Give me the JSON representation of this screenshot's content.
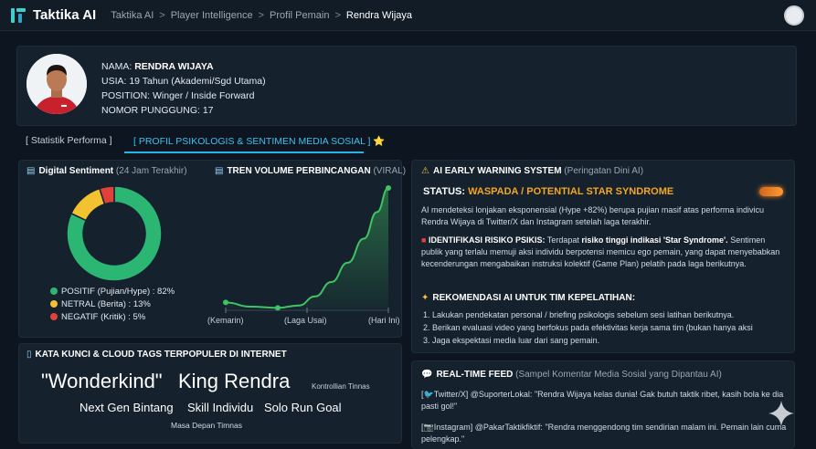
{
  "app": {
    "name": "Taktika AI",
    "breadcrumb": [
      "Taktika AI",
      "Player Intelligence",
      "Profil Pemain",
      "Rendra Wijaya"
    ]
  },
  "profile": {
    "name_label": "NAMA:",
    "name": "RENDRA WIJAYA",
    "age": "USIA: 19 Tahun (Akademi/Sgd Utama)",
    "position": "POSITION: Winger / Inside Forward",
    "number": "NOMOR PUNGGUNG: 17"
  },
  "tabs": [
    {
      "label": "[ Statistik Performa ]"
    },
    {
      "label": "[ PROFIL PSIKOLOGIS & SENTIMEN MEDIA SOSIAL ] ⭐"
    }
  ],
  "sentiment": {
    "title": "Digital Sentiment",
    "subtitle": "(24 Jam Terakhir)",
    "legend": [
      {
        "label": "POSITIF (Pujian/Hype) : 82%",
        "color": "#2bb673"
      },
      {
        "label": "NETRAL (Berita) : 13%",
        "color": "#f2c230"
      },
      {
        "label": "NEGATIF (Kritik) : 5%",
        "color": "#e0423b"
      }
    ]
  },
  "trend": {
    "title": "TREN VOLUME PERBINCANGAN",
    "subtitle": "(VIRAL)"
  },
  "chart_data": [
    {
      "type": "pie",
      "categories": [
        "POSITIF (Pujian/Hype)",
        "NETRAL (Berita)",
        "NEGATIF (Kritik)"
      ],
      "values": [
        82,
        13,
        5
      ],
      "colors": [
        "#2bb673",
        "#f2c230",
        "#e0423b"
      ],
      "title": "Digital Sentiment"
    },
    {
      "type": "area",
      "categories": [
        "(Kemarin)",
        "(Laga Usai)",
        "(Hari Ini)"
      ],
      "x": [
        0,
        0.15,
        0.32,
        0.45,
        0.55,
        0.65,
        0.75,
        0.85,
        0.93,
        1.0
      ],
      "values": [
        5,
        1.5,
        0.5,
        2.5,
        10,
        22,
        38,
        58,
        80,
        100
      ],
      "ylim": [
        0,
        100
      ],
      "color": "#3fc463",
      "title": "TREN VOLUME PERBINCANGAN"
    }
  ],
  "keywords": {
    "title": "KATA KUNCI & CLOUD TAGS TERPOPULER DI INTERNET",
    "tags": [
      {
        "text": "\"Wonderkind\"",
        "size": 22
      },
      {
        "text": "King Rendra",
        "size": 22
      },
      {
        "text": "Kontrollian Tinnas",
        "size": 8
      },
      {
        "text": "Next Gen Bintang",
        "size": 13
      },
      {
        "text": "Skill Individu",
        "size": 13
      },
      {
        "text": "Solo Run Goal",
        "size": 13
      },
      {
        "text": "Masa Depan Timnas",
        "size": 8.5
      }
    ]
  },
  "warning": {
    "title": "AI EARLY WARNING SYSTEM",
    "subtitle": "(Peringatan Dini AI)",
    "status_label": "STATUS:",
    "status_value": "WASPADA / POTENTIAL STAR SYNDROME",
    "detection": "AI mendeteksi lonjakan eksponensial (Hype +82%) berupa pujian masif atas performa indivicu Rendra Wijaya di Twitter/X dan Instagram setelah laga terakhir.",
    "risk_title": "IDENTIFIKASI RISIKO PSIKIS:",
    "risk_intro": "Terdapat",
    "risk_highlight": "risiko tinggi indikasi 'Star Syndrome'.",
    "risk_body": "Sentimen publik yang terlalu memuji aksi individu berpotensi memicu ego pemain, yang dapat menyebabkan kecenderungan mengabaikan instruksi kolektif (Game Plan) pelatih pada laga berikutnya.",
    "rec_title": "REKOMENDASI AI UNTUK TIM KEPELATIHAN:",
    "recommendations": [
      "Lakukan pendekatan personal / briefing psikologis sebelum sesi latihan berikutnya.",
      "Berikan evaluasi video yang berfokus pada efektivitas kerja sama tim (bukan hanya aksi",
      "Jaga ekspektasi media luar dari sang pemain."
    ]
  },
  "feed": {
    "title": "REAL-TIME FEED",
    "subtitle": "(Sampel Komentar Media Sosial yang Dipantau AI)",
    "items": [
      {
        "source": "Twitter/X]",
        "user": "@SuporterLokal:",
        "text": "\"Rendra Wijaya kelas dunia! Gak butuh taktik ribet, kasih bola ke dia pasti gol!\""
      },
      {
        "source": "Instagram]",
        "user": "@PakarTaktikfiktif:",
        "text": "\"Rendra menggendong tim sendirian malam ini. Pemain lain cuma pelengkap.\""
      }
    ]
  }
}
